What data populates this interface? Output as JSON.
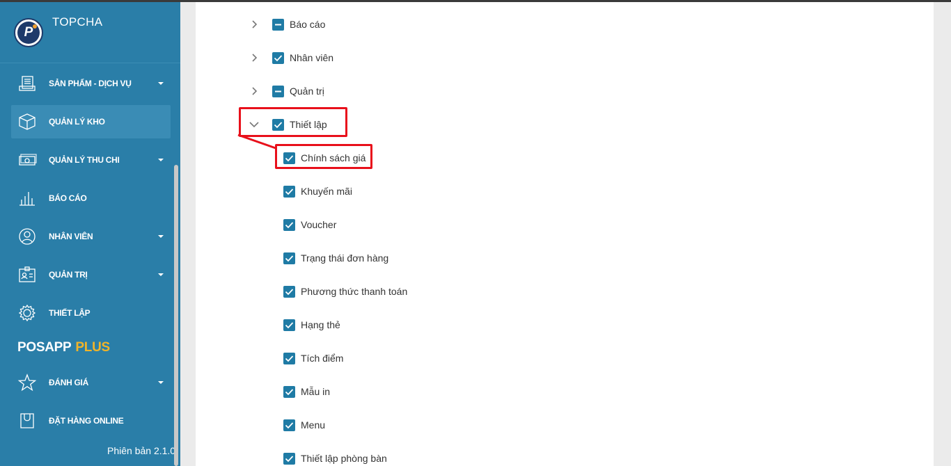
{
  "sidebar": {
    "brand": "TOPCHA",
    "logo_letter": "P",
    "items": [
      {
        "label": "SẢN PHẨM - DỊCH VỤ",
        "icon": "products-icon",
        "has_caret": true
      },
      {
        "label": "QUẢN LÝ KHO",
        "icon": "box-icon",
        "has_caret": false,
        "active": true
      },
      {
        "label": "QUẢN LÝ THU CHI",
        "icon": "money-icon",
        "has_caret": true
      },
      {
        "label": "BÁO CÁO",
        "icon": "chart-icon",
        "has_caret": false
      },
      {
        "label": "NHÂN VIÊN",
        "icon": "user-icon",
        "has_caret": true
      },
      {
        "label": "QUẢN TRỊ",
        "icon": "id-card-icon",
        "has_caret": true
      },
      {
        "label": "THIẾT LẬP",
        "icon": "gear-icon",
        "has_caret": false
      }
    ],
    "section_title": "POSAPP",
    "section_title_plus": "PLUS",
    "plus_items": [
      {
        "label": "ĐÁNH GIÁ",
        "icon": "star-icon",
        "has_caret": true
      },
      {
        "label": "ĐẶT HÀNG ONLINE",
        "icon": "bag-icon",
        "has_caret": false
      }
    ],
    "version": "Phiên bản 2.1.0"
  },
  "permissions": {
    "groups": [
      {
        "label": "Báo cáo",
        "state": "indeterminate",
        "expanded": false
      },
      {
        "label": "Nhân viên",
        "state": "checked",
        "expanded": false
      },
      {
        "label": "Quản trị",
        "state": "indeterminate",
        "expanded": false
      },
      {
        "label": "Thiết lập",
        "state": "checked",
        "expanded": true
      }
    ],
    "children": [
      {
        "label": "Chính sách giá",
        "state": "checked"
      },
      {
        "label": "Khuyến mãi",
        "state": "checked"
      },
      {
        "label": "Voucher",
        "state": "checked"
      },
      {
        "label": "Trạng thái đơn hàng",
        "state": "checked"
      },
      {
        "label": "Phương thức thanh toán",
        "state": "checked"
      },
      {
        "label": "Hạng thẻ",
        "state": "checked"
      },
      {
        "label": "Tích điểm",
        "state": "checked"
      },
      {
        "label": "Mẫu in",
        "state": "checked"
      },
      {
        "label": "Menu",
        "state": "checked"
      },
      {
        "label": "Thiết lập phòng bàn",
        "state": "checked"
      }
    ]
  },
  "colors": {
    "sidebar_bg": "#2a7ea8",
    "checkbox": "#1f7ba5",
    "highlight": "#e8101b",
    "plus_accent": "#f0b429"
  }
}
